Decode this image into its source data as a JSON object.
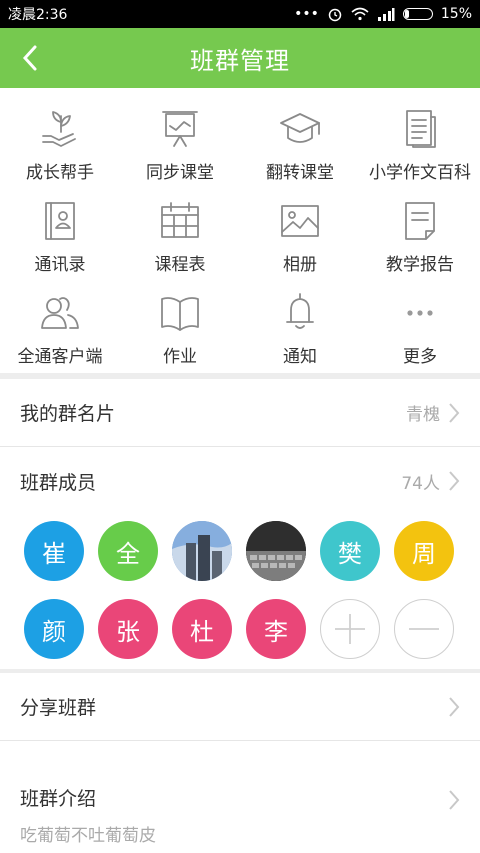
{
  "status": {
    "time": "凌晨2:36",
    "battery_percent": "15%",
    "battery_level": 0.15
  },
  "header": {
    "title": "班群管理"
  },
  "grid_items": [
    {
      "label": "成长帮手",
      "icon": "hand-plant-icon"
    },
    {
      "label": "同步课堂",
      "icon": "presentation-board-icon"
    },
    {
      "label": "翻转课堂",
      "icon": "graduation-cap-icon"
    },
    {
      "label": "小学作文百科",
      "icon": "document-icon"
    },
    {
      "label": "通讯录",
      "icon": "contact-book-icon"
    },
    {
      "label": "课程表",
      "icon": "calendar-icon"
    },
    {
      "label": "相册",
      "icon": "photo-icon"
    },
    {
      "label": "教学报告",
      "icon": "report-icon"
    },
    {
      "label": "全通客户端",
      "icon": "users-icon"
    },
    {
      "label": "作业",
      "icon": "open-book-icon"
    },
    {
      "label": "通知",
      "icon": "bell-icon"
    },
    {
      "label": "更多",
      "icon": "more-dots-icon"
    }
  ],
  "card": {
    "label": "我的群名片",
    "value": "青槐"
  },
  "members_row": {
    "label": "班群成员",
    "count": "74人"
  },
  "members": [
    {
      "text": "崔",
      "color": "#1da0e4"
    },
    {
      "text": "全",
      "color": "#67cc4a"
    },
    {
      "text": "",
      "color": "#7a9fc8",
      "type": "photo-sky"
    },
    {
      "text": "",
      "color": "#3b3b3b",
      "type": "photo-keyboard"
    },
    {
      "text": "樊",
      "color": "#3fc6cc"
    },
    {
      "text": "周",
      "color": "#f3c30f"
    },
    {
      "text": "颜",
      "color": "#1da0e4"
    },
    {
      "text": "张",
      "color": "#ea4678"
    },
    {
      "text": "杜",
      "color": "#ea4678"
    },
    {
      "text": "李",
      "color": "#ea4678"
    }
  ],
  "share": {
    "label": "分享班群"
  },
  "intro": {
    "label": "班群介绍",
    "desc": "吃葡萄不吐葡萄皮"
  },
  "colors": {
    "green": "#76c94f"
  }
}
